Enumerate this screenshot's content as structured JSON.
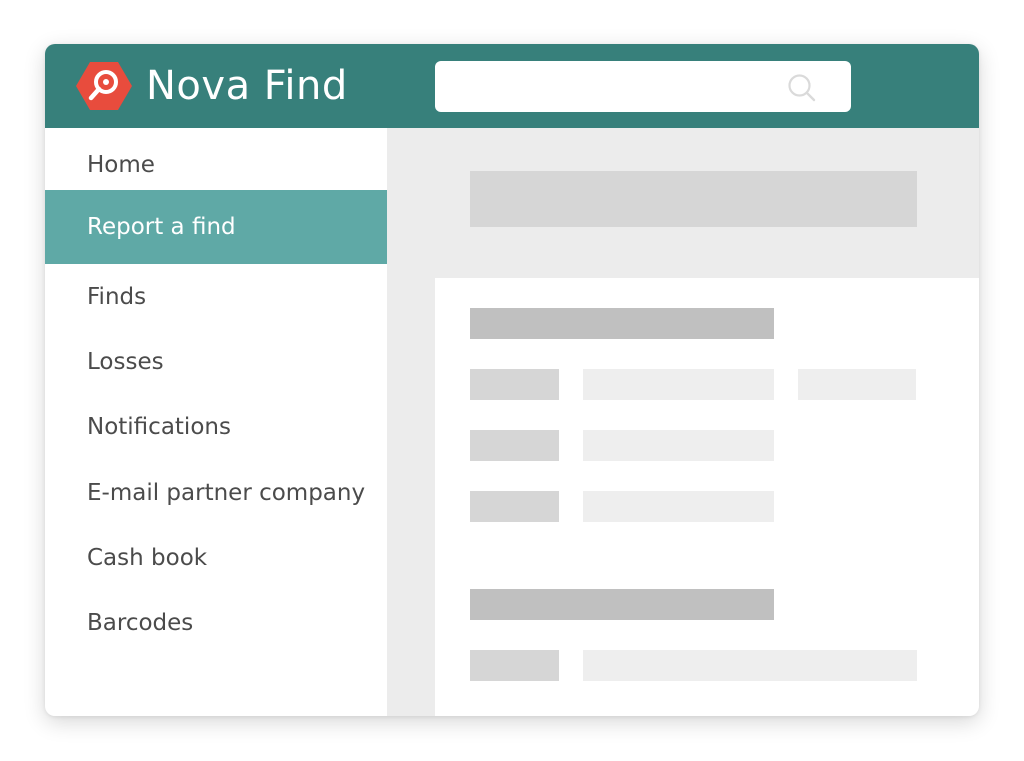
{
  "app": {
    "title": "Nova Find",
    "brand_color": "#37807b",
    "accent_color": "#5fa9a6",
    "logo_color": "#e84c3d"
  },
  "search": {
    "placeholder": "",
    "value": "",
    "icon": "search-icon"
  },
  "sidebar": {
    "active_index": 1,
    "items": [
      {
        "label": "Home"
      },
      {
        "label": "Report a find"
      },
      {
        "label": "Finds"
      },
      {
        "label": "Losses"
      },
      {
        "label": "Notifications"
      },
      {
        "label": "E-mail partner company"
      },
      {
        "label": "Cash book"
      },
      {
        "label": "Barcodes"
      }
    ]
  }
}
